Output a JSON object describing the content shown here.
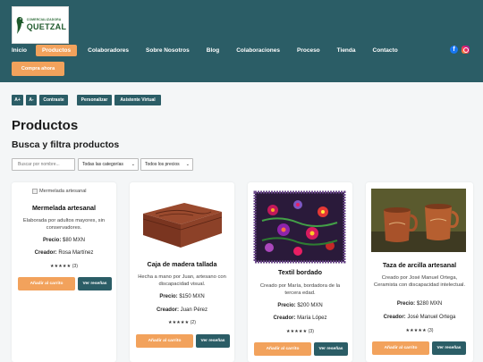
{
  "brand": {
    "name_small": "COMERCIALIZADORA",
    "name_big": "QUETZAL"
  },
  "nav": {
    "items": [
      "Inicio",
      "Productos",
      "Colaboradores",
      "Sobre Nosotros",
      "Blog",
      "Colaboraciones",
      "Proceso",
      "Tienda",
      "Contacto"
    ],
    "active": "Productos",
    "social": [
      "facebook-icon",
      "instagram-icon"
    ]
  },
  "header": {
    "buy_label": "Compra ahora"
  },
  "accessibility": {
    "increase_label": "A+",
    "decrease_label": "A-",
    "contrast_label": "Contraste",
    "customize_label": "Personalizar",
    "assistant_label": "Asistente Virtual"
  },
  "page": {
    "title": "Productos",
    "subtitle": "Busca y filtra productos"
  },
  "filters": {
    "search_placeholder": "Buscar por nombre...",
    "category_value": "Todas las categorías",
    "price_value": "Todos los precios"
  },
  "products": [
    {
      "image_alt": "Mermelada artesanal",
      "title": "Mermelada artesanal",
      "description": "Elaborada por adultos mayores, sin conservadores.",
      "price_label": "Precio:",
      "price": "$80 MXN",
      "creator_label": "Creador:",
      "creator": "Rosa Martínez",
      "stars": "★★★★★",
      "reviews": "(3)",
      "cart_label": "Añadir al carrito",
      "reviews_label": "Ver reseñas"
    },
    {
      "image_alt": "Caja de madera tallada",
      "title": "Caja de madera tallada",
      "description": "Hecha a mano por Juan, artesano con discapacidad visual.",
      "price_label": "Precio:",
      "price": "$150 MXN",
      "creator_label": "Creador:",
      "creator": "Juan Pérez",
      "stars": "★★★★★",
      "reviews": "(2)",
      "cart_label": "Añadir al carrito",
      "reviews_label": "Ver reseñas"
    },
    {
      "image_alt": "Textil bordado",
      "title": "Textil bordado",
      "description": "Creado por María, bordadora de la tercera edad.",
      "price_label": "Precio:",
      "price": "$200 MXN",
      "creator_label": "Creador:",
      "creator": "María López",
      "stars": "★★★★★",
      "reviews": "(3)",
      "cart_label": "Añadir al carrito",
      "reviews_label": "Ver reseñas"
    },
    {
      "image_alt": "Taza de arcilla artesanal",
      "title": "Taza de arcilla artesanal",
      "description": "Creado por José Manuel Ortega, Ceramista con discapacidad intelectual.",
      "price_label": "Precio:",
      "price": "$280 MXN",
      "creator_label": "Creador:",
      "creator": "José Manuel Ortega",
      "stars": "★★★★★",
      "reviews": "(3)",
      "cart_label": "Añadir al carrito",
      "reviews_label": "Ver reseñas"
    }
  ],
  "colors": {
    "header_bg": "#2b5d66",
    "accent_orange": "#f2a25c",
    "page_bg": "#f4f6f7"
  }
}
